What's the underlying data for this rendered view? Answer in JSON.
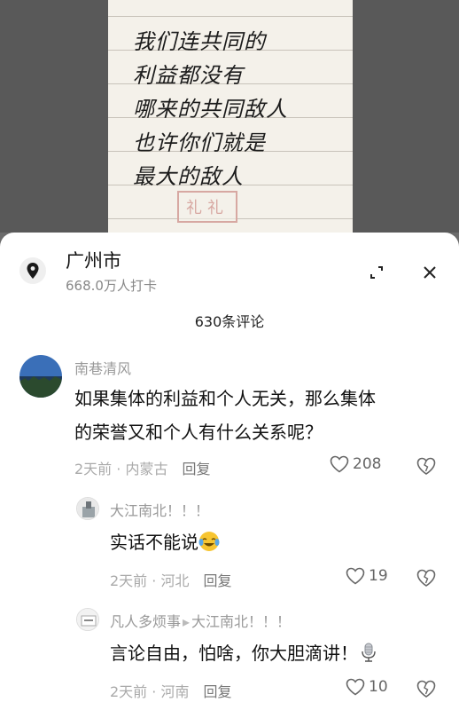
{
  "image": {
    "note_lines": [
      "我们连共同的",
      "利益都没有",
      "哪来的共同敌人",
      "也许你们就是",
      "最大的敌人"
    ],
    "seal": "礼礼"
  },
  "location": {
    "title": "广州市",
    "checkins": "668.0万人打卡",
    "pin_icon": "location-pin-icon",
    "expand_icon": "expand-icon",
    "close_icon": "close-icon"
  },
  "comments_header": "630条评论",
  "comments": [
    {
      "user": "南巷清风",
      "text_line1": "如果集体的利益和个人无关，那么集体",
      "text_line2": "的荣誉又和个人有什么关系呢？",
      "time": "2天前",
      "region": "内蒙古",
      "reply": "回复",
      "likes": "208"
    },
    {
      "user": "大江南北！！！",
      "text": "实话不能说",
      "emoji": "laughing-crying-emoji",
      "time": "2天前",
      "region": "河北",
      "reply": "回复",
      "likes": "19"
    },
    {
      "user": "凡人多烦事",
      "reply_to": "大江南北！！！",
      "text": "言论自由，怕啥，你大胆滴讲！",
      "emoji": "microphone-emoji",
      "time": "2天前",
      "region": "河南",
      "reply": "回复",
      "likes": "10"
    }
  ],
  "colors": {
    "sheet": "#ffffff",
    "muted": "#999999",
    "text": "#111111"
  }
}
